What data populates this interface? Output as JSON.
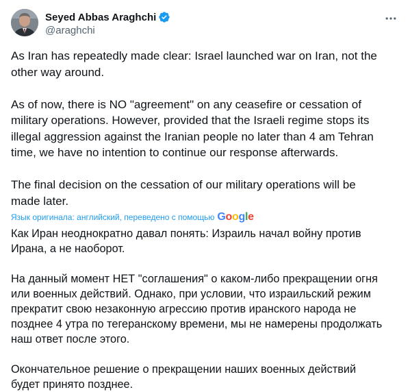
{
  "author": {
    "display_name": "Seyed Abbas Araghchi",
    "handle": "@araghchi",
    "verified": true,
    "avatar_icon": "avatar-photo"
  },
  "tweet": {
    "paragraphs": [
      "As Iran has repeatedly made clear: Israel launched war on Iran, not the\nother way around.",
      "As of now, there is NO \"agreement\" on any ceasefire or cessation of\nmilitary operations. However, provided that the Israeli regime stops its\nillegal aggression against the Iranian people no later than 4 am Tehran\ntime, we have no intention to continue our response afterwards.",
      "The final decision on the cessation of our military operations will be\nmade later."
    ]
  },
  "translation": {
    "label": "Язык оригинала: английский, переведено с помощью",
    "provider": "Google",
    "paragraphs": [
      "Как Иран неоднократно давал понять: Израиль начал войну против\nИрана, а не наоборот.",
      "На данный момент НЕТ \"соглашения\" о каком-либо прекращении огня\nили военных действий. Однако, при условии, что израильский режим\nпрекратит свою незаконную агрессию против иранского народа не\nпозднее 4 утра по тегеранскому времени, мы не намерены продолжать\nнаш ответ после этого.",
      "Окончательное решение о прекращении наших военных действий\nбудет принято позднее."
    ]
  },
  "colors": {
    "text": "#0f1419",
    "secondary": "#536471",
    "link": "#1d9bf0",
    "verified_badge": "#1d9bf0",
    "google_blue": "#4285f4",
    "google_red": "#ea4335",
    "google_yellow": "#fbbc05",
    "google_green": "#34a853"
  },
  "icons": {
    "more": "more-horizontal-icon",
    "verified": "verified-badge-icon"
  }
}
